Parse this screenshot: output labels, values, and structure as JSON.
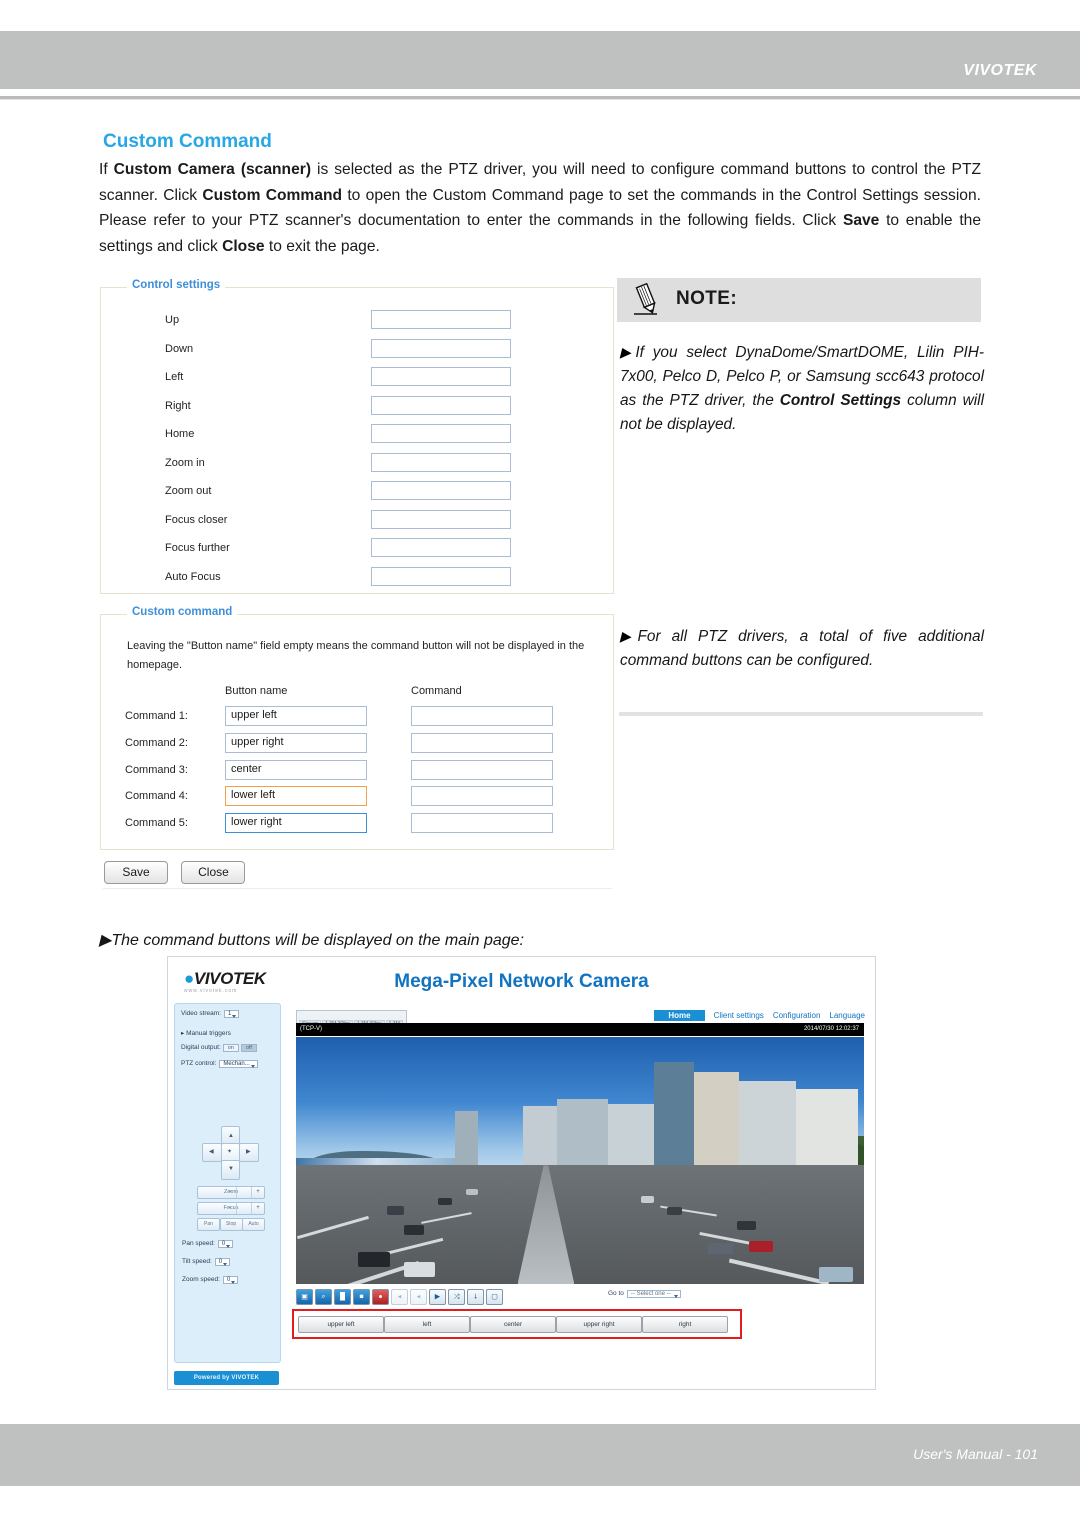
{
  "header": {
    "brand": "VIVOTEK"
  },
  "footer": {
    "text": "User's Manual - 101"
  },
  "section": {
    "title": "Custom Command",
    "paragraph_html": "If <b>Custom Camera (scanner)</b> is selected as the PTZ driver, you will need to configure command buttons to control the PTZ scanner. Click <b>Custom Command</b> to open the Custom Command page to set the commands in the Control Settings session. Please refer to your PTZ scanner's documentation to enter the commands in the following fields. Click <b>Save</b> to enable the settings and click <b>Close</b> to exit the page."
  },
  "control_settings": {
    "legend": "Control settings",
    "rows": [
      {
        "label": "Up",
        "value": ""
      },
      {
        "label": "Down",
        "value": ""
      },
      {
        "label": "Left",
        "value": ""
      },
      {
        "label": "Right",
        "value": ""
      },
      {
        "label": "Home",
        "value": ""
      },
      {
        "label": "Zoom in",
        "value": ""
      },
      {
        "label": "Zoom out",
        "value": ""
      },
      {
        "label": "Focus closer",
        "value": ""
      },
      {
        "label": "Focus further",
        "value": ""
      },
      {
        "label": "Auto Focus",
        "value": ""
      }
    ]
  },
  "custom_command": {
    "legend": "Custom command",
    "hint": "Leaving the \"Button name\" field empty means the command button will not be displayed in the homepage.",
    "col_button_name": "Button name",
    "col_command": "Command",
    "rows": [
      {
        "label": "Command 1:",
        "button_name": "upper left",
        "command": "",
        "highlight": "none"
      },
      {
        "label": "Command 2:",
        "button_name": "upper right",
        "command": "",
        "highlight": "none"
      },
      {
        "label": "Command 3:",
        "button_name": "center",
        "command": "",
        "highlight": "none"
      },
      {
        "label": "Command 4:",
        "button_name": "lower left",
        "command": "",
        "highlight": "orange"
      },
      {
        "label": "Command 5:",
        "button_name": "lower right",
        "command": "",
        "highlight": "blue"
      }
    ]
  },
  "form_buttons": {
    "save": "Save",
    "close": "Close"
  },
  "note": {
    "title": "NOTE:",
    "bullet_arrow": "▶",
    "item1_html": "If you select DynaDome/SmartDOME, Lilin PIH-7x00, Pelco D, Pelco P, or Samsung  scc643 protocol as the PTZ driver, the <b>Control Settings</b> column will not be displayed.",
    "item2": "For all PTZ drivers, a total of five additional command buttons can be configured."
  },
  "caption": "The command buttons will be displayed on the main page:",
  "camera_page": {
    "logo": "VIVOTEK",
    "logo_sub": "www.vivotek.com",
    "title": "Mega-Pixel Network Camera",
    "nav": [
      {
        "label": "Home",
        "active": true
      },
      {
        "label": "Client settings",
        "active": false
      },
      {
        "label": "Configuration",
        "active": false
      },
      {
        "label": "Language",
        "active": false
      }
    ],
    "stream_badges": [
      "Stream",
      "1.3M 30fps",
      "1.3M 30fps",
      "1.3M"
    ],
    "status_protocol": "(TCP-V)",
    "status_timestamp": "2014/07/30 12:02:37",
    "sidebar": {
      "video_stream_label": "Video stream:",
      "video_stream_value": "1",
      "manual_trigger_label": "Manual triggers",
      "digital_output_label": "Digital output:",
      "digital_output_on": "on",
      "digital_output_off": "off",
      "ptz_control_label": "PTZ control:",
      "ptz_control_value": "Mechan...",
      "zoom_label": "Zoom",
      "focus_label": "Focus",
      "minus": "−",
      "plus": "+",
      "trio": [
        "Pan",
        "Stop",
        "Auto"
      ],
      "pan_speed_label": "Pan speed:",
      "pan_speed_value": "0",
      "tilt_speed_label": "Tilt speed:",
      "tilt_speed_value": "0",
      "zoom_speed_label": "Zoom speed:",
      "zoom_speed_value": "0",
      "powered_by": "Powered by VIVOTEK"
    },
    "toolbar": {
      "icons": [
        "snapshot-icon",
        "zoom-icon",
        "pause-icon",
        "stop-icon",
        "record-icon",
        "volume-icon",
        "mute-icon",
        "play-icon",
        "ptz-icon",
        "talk-icon",
        "fullscreen-icon"
      ],
      "goto_label": "Go to",
      "goto_value": "-- Select one --"
    },
    "command_buttons": [
      "upper left",
      "left",
      "center",
      "upper right",
      "right"
    ]
  }
}
